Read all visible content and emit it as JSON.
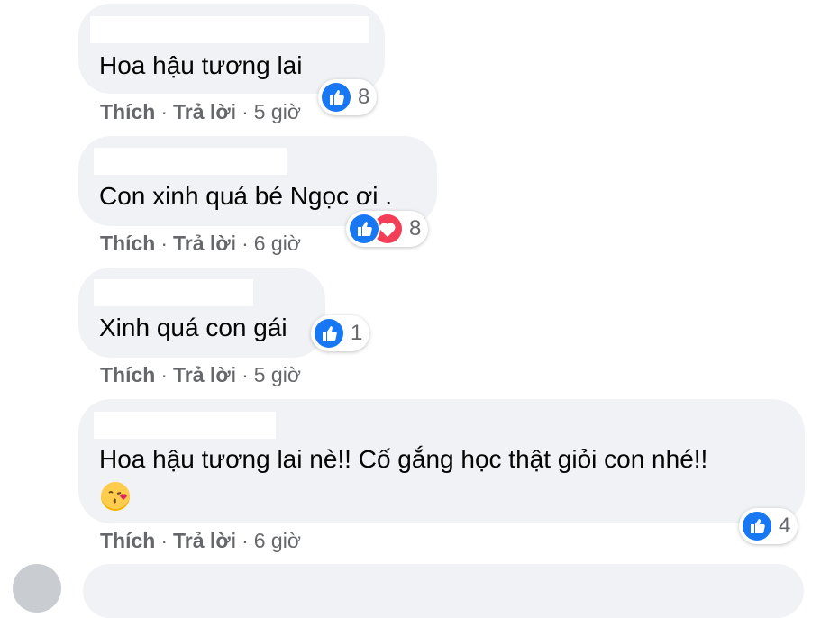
{
  "comments": [
    {
      "text": "Hoa hậu tương lai",
      "like_label": "Thích",
      "reply_label": "Trả lời",
      "time": "5 giờ",
      "reaction_count": "8"
    },
    {
      "text": "Con xinh quá bé Ngọc ơi .",
      "like_label": "Thích",
      "reply_label": "Trả lời",
      "time": "6 giờ",
      "reaction_count": "8"
    },
    {
      "text": "Xinh quá con gái",
      "like_label": "Thích",
      "reply_label": "Trả lời",
      "time": "5 giờ",
      "reaction_count": "1"
    },
    {
      "text": "Hoa hậu tương lai nè!! Cố gắng học thật giỏi con nhé!!",
      "like_label": "Thích",
      "reply_label": "Trả lời",
      "time": "6 giờ",
      "reaction_count": "4",
      "emoji": "kissing-heart-emoji"
    }
  ],
  "meta_separator": "·",
  "colors": {
    "bubble": "#f0f2f5",
    "like": "#1877f2",
    "love": "#f33e58",
    "meta": "#65676b"
  },
  "icons": {
    "like": "thumbs-up-icon",
    "love": "heart-icon"
  }
}
